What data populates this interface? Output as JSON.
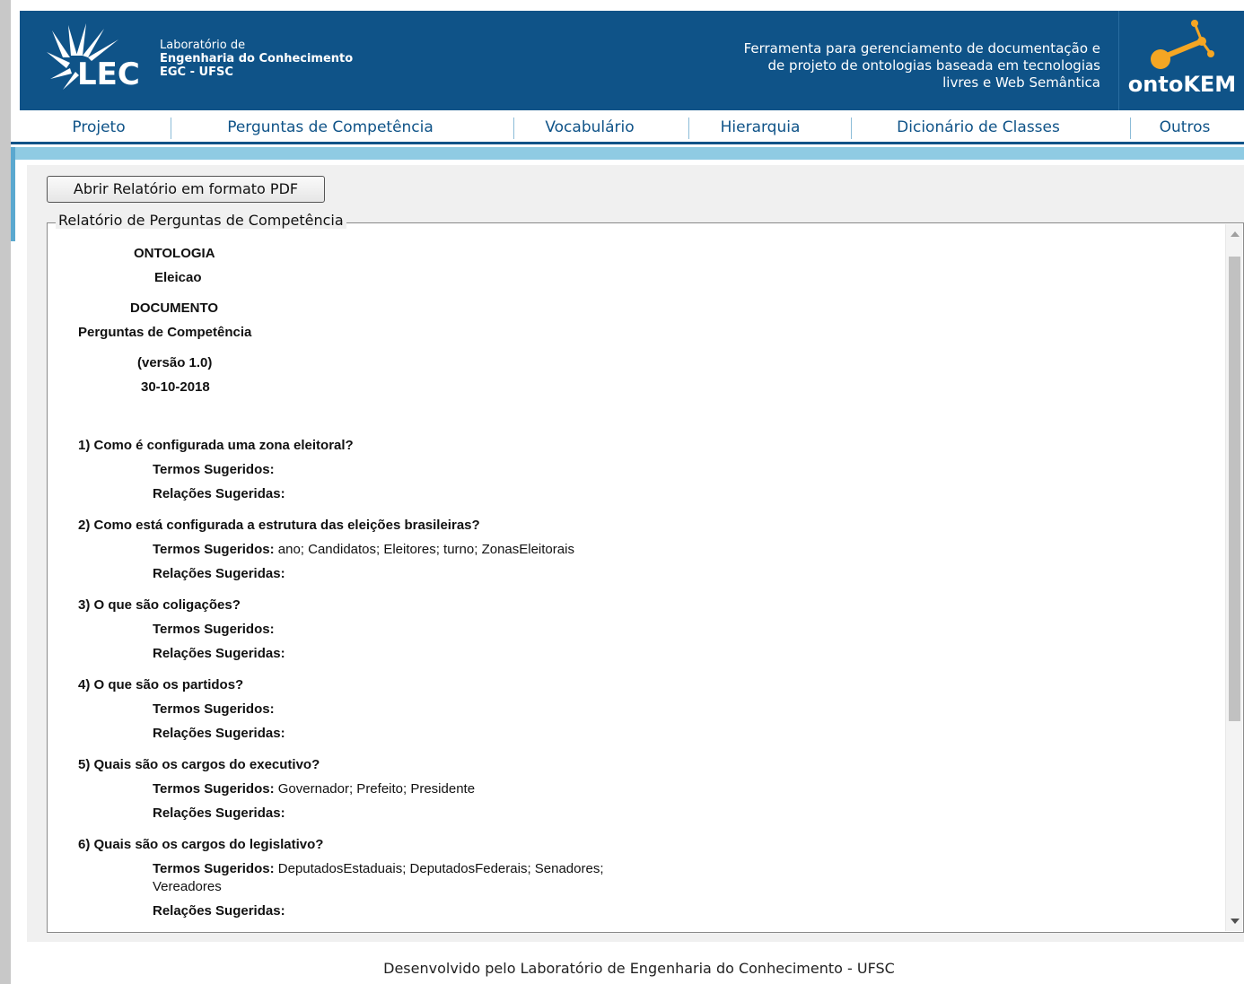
{
  "header": {
    "lab_line1": "Laboratório de",
    "lab_line2": "Engenharia do Conhecimento",
    "lab_line3": "EGC - UFSC",
    "lec_acronym": "LEC",
    "tagline_line1": "Ferramenta para gerenciamento de documentação e",
    "tagline_line2": "de projeto de ontologias baseada em tecnologias",
    "tagline_line3": "livres e Web Semântica",
    "product_name": "ontoKEM"
  },
  "nav": {
    "items": [
      {
        "label": "Projeto"
      },
      {
        "label": "Perguntas de Competência"
      },
      {
        "label": "Vocabulário"
      },
      {
        "label": "Hierarquia"
      },
      {
        "label": "Dicionário de Classes"
      },
      {
        "label": "Outros"
      }
    ]
  },
  "toolbar": {
    "pdf_button_label": "Abrir Relatório em formato PDF"
  },
  "report": {
    "legend": "Relatório de Perguntas de Competência",
    "ontology_heading": "ONTOLOGIA",
    "ontology_name": "Eleicao",
    "document_heading": "DOCUMENTO",
    "document_name": "Perguntas de Competência",
    "version": "(versão 1.0)",
    "date": "30-10-2018",
    "terms_label": "Termos Sugeridos:",
    "relations_label": "Relações Sugeridas:",
    "questions": [
      {
        "text": "1) Como é configurada uma zona eleitoral?",
        "terms": "",
        "relations": ""
      },
      {
        "text": "2) Como está configurada a estrutura das eleições brasileiras?",
        "terms": "ano; Candidatos; Eleitores; turno; ZonasEleitorais",
        "relations": ""
      },
      {
        "text": "3) O que são coligações?",
        "terms": "",
        "relations": ""
      },
      {
        "text": "4) O que são os partidos?",
        "terms": "",
        "relations": ""
      },
      {
        "text": "5) Quais são os cargos do executivo?",
        "terms": "Governador; Prefeito; Presidente",
        "relations": ""
      },
      {
        "text": "6) Quais são os cargos do legislativo?",
        "terms": "DeputadosEstaduais; DeputadosFederais; Senadores;",
        "terms_cont": "Vereadores",
        "relations": ""
      }
    ]
  },
  "footer": {
    "text": "Desenvolvido pelo Laboratório de Engenharia do Conhecimento - UFSC"
  },
  "colors": {
    "banner": "#0f5388",
    "nav_text": "#0f5388",
    "nav_strip": "#8fcbe3",
    "logo_accent": "#f5a623"
  }
}
